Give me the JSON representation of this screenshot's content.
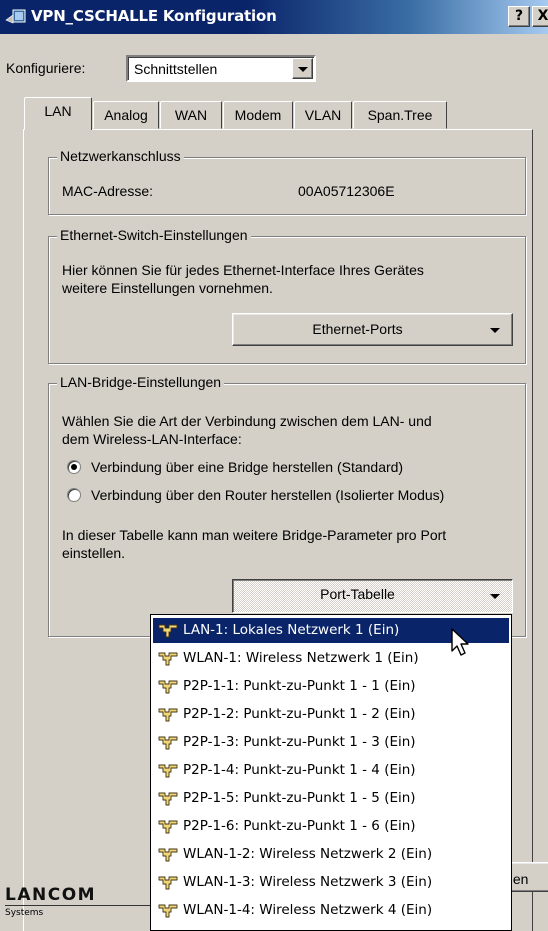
{
  "window": {
    "title": "VPN_CSCHALLE Konfiguration",
    "help_button": "?",
    "close_button": "X"
  },
  "configure": {
    "label": "Konfiguriere:",
    "selected": "Schnittstellen"
  },
  "tabs": [
    {
      "label": "LAN",
      "active": true
    },
    {
      "label": "Analog"
    },
    {
      "label": "WAN"
    },
    {
      "label": "Modem"
    },
    {
      "label": "VLAN"
    },
    {
      "label": "Span.Tree"
    }
  ],
  "netzwerk": {
    "title": "Netzwerkanschluss",
    "mac_label": "MAC-Adresse:",
    "mac_value": "00A05712306E"
  },
  "ethernet": {
    "title": "Ethernet-Switch-Einstellungen",
    "text1": "Hier können Sie für jedes Ethernet-Interface Ihres Gerätes",
    "text2": "weitere Einstellungen vornehmen.",
    "button": "Ethernet-Ports"
  },
  "bridge": {
    "title": "LAN-Bridge-Einstellungen",
    "text1": "Wählen Sie die Art der Verbindung zwischen dem LAN- und",
    "text2": "dem Wireless-LAN-Interface:",
    "radio1": "Verbindung über eine Bridge herstellen (Standard)",
    "radio2": "Verbindung über den Router herstellen (Isolierter Modus)",
    "text3": "In dieser Tabelle kann man weitere Bridge-Parameter pro Port",
    "text4": "einstellen.",
    "button": "Port-Tabelle"
  },
  "logo": {
    "name": "LANCOM",
    "sub": "Systems"
  },
  "partial_button": "ıen",
  "port_list": [
    "LAN-1: Lokales Netzwerk 1 (Ein)",
    "WLAN-1: Wireless Netzwerk 1 (Ein)",
    "P2P-1-1: Punkt-zu-Punkt 1 - 1 (Ein)",
    "P2P-1-2: Punkt-zu-Punkt 1 - 2 (Ein)",
    "P2P-1-3: Punkt-zu-Punkt 1 - 3 (Ein)",
    "P2P-1-4: Punkt-zu-Punkt 1 - 4 (Ein)",
    "P2P-1-5: Punkt-zu-Punkt 1 - 5 (Ein)",
    "P2P-1-6: Punkt-zu-Punkt 1 - 6 (Ein)",
    "WLAN-1-2: Wireless Netzwerk 2 (Ein)",
    "WLAN-1-3: Wireless Netzwerk 3 (Ein)",
    "WLAN-1-4: Wireless Netzwerk 4 (Ein)"
  ],
  "selected_port_index": 0,
  "colors": {
    "titlebar": "#0a246a",
    "selection": "#0a246a",
    "face": "#d4d0c8"
  },
  "icons": {
    "app": "network-config-icon",
    "port": "ethernet-port-icon",
    "cursor": "mouse-pointer-icon"
  }
}
